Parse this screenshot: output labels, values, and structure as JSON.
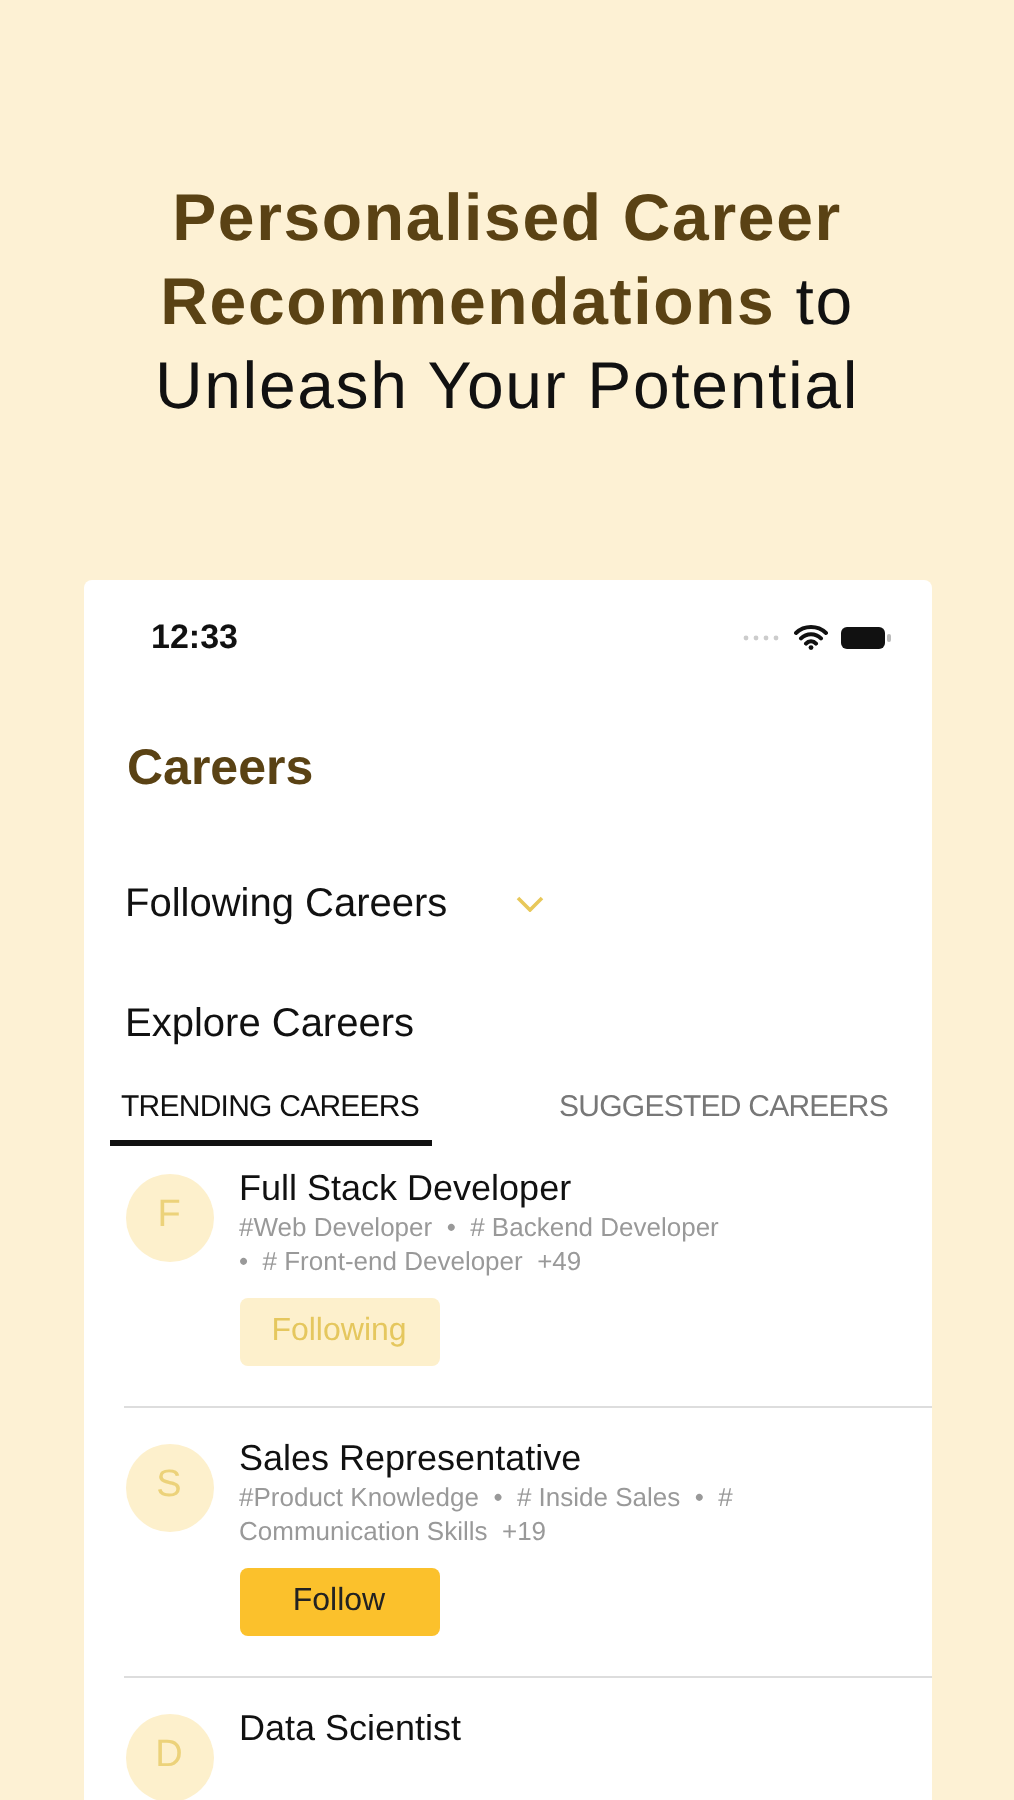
{
  "headline": "**Personalised Career Recommendations** to Unleash Your Potential",
  "status_bar": {
    "time": "12:33"
  },
  "page_title": "Careers",
  "sections": [
    {
      "label": "Following Careers",
      "expanded": false
    },
    {
      "label": "Explore Careers"
    }
  ],
  "tabs": [
    {
      "label": "TRENDING CAREERS",
      "selected": true
    },
    {
      "label": "SUGGESTED CAREERS",
      "selected": false
    }
  ],
  "careers": [
    {
      "initial": "F",
      "title": "Full Stack Developer",
      "tags": "#Web Developer  •  # Backend Developer  •  # Front-end Developer  +49",
      "button": {
        "label": "Following",
        "following": true
      }
    },
    {
      "initial": "S",
      "title": "Sales Representative",
      "tags": "#Product Knowledge  •  # Inside Sales  •  # Communication Skills  +19",
      "button": {
        "label": "Follow",
        "following": false
      }
    },
    {
      "initial": "D",
      "title": "Data Scientist"
    }
  ]
}
